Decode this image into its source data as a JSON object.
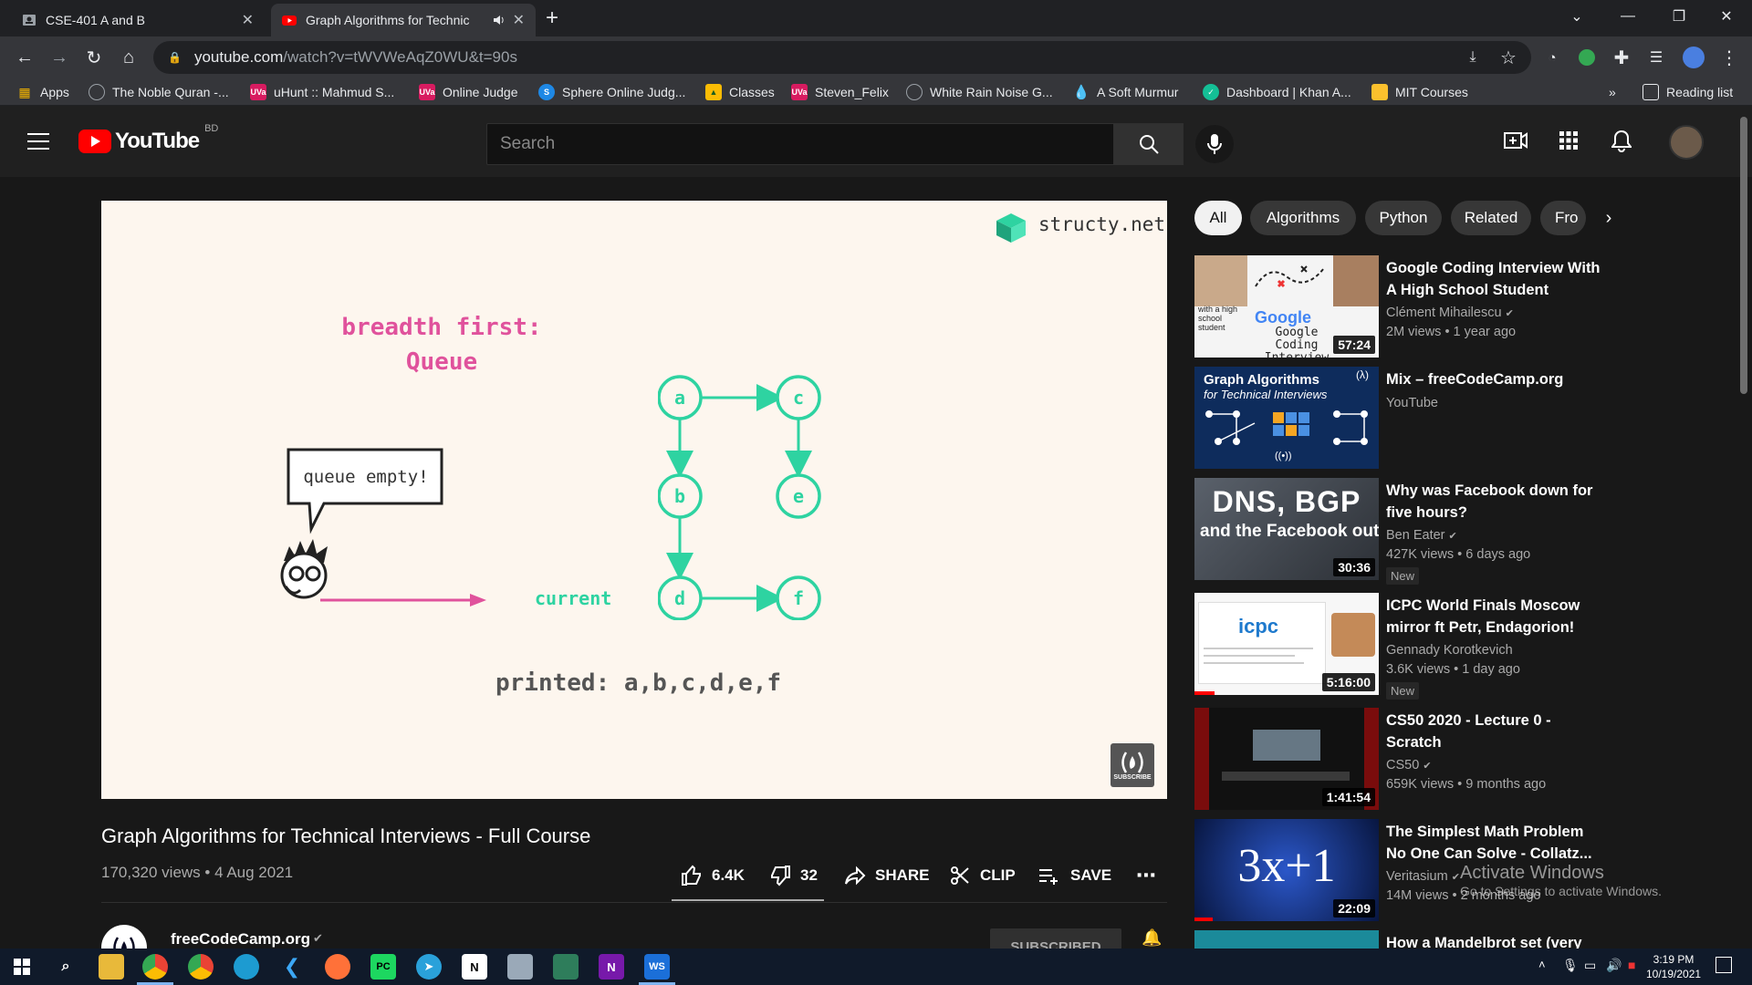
{
  "browser": {
    "tabs": [
      {
        "title": "CSE-401 A and B"
      },
      {
        "title": "Graph Algorithms for Technic"
      }
    ],
    "url_host": "youtube.com",
    "url_path": "/watch?v=tWVWeAqZ0WU&t=90s",
    "bookmarks": [
      {
        "label": "Apps",
        "icon": "apps-grid-icon",
        "color": "#f4b400"
      },
      {
        "label": "The Noble Quran -...",
        "icon": "globe-icon",
        "color": "#9aa0a6"
      },
      {
        "label": "uHunt :: Mahmud S...",
        "icon": "uva-icon",
        "color": "#d81b60"
      },
      {
        "label": "Online Judge",
        "icon": "uva-icon",
        "color": "#d81b60"
      },
      {
        "label": "Sphere Online Judg...",
        "icon": "spoj-icon",
        "color": "#1e88e5"
      },
      {
        "label": "Classes",
        "icon": "classroom-icon",
        "color": "#fbbc04"
      },
      {
        "label": "Steven_Felix",
        "icon": "uva-icon",
        "color": "#d81b60"
      },
      {
        "label": "White Rain Noise G...",
        "icon": "globe-icon",
        "color": "#9aa0a6"
      },
      {
        "label": "A Soft Murmur",
        "icon": "drop-icon",
        "color": "#4fc3f7"
      },
      {
        "label": "Dashboard | Khan A...",
        "icon": "khan-icon",
        "color": "#14bf96"
      },
      {
        "label": "MIT Courses",
        "icon": "folder-icon",
        "color": "#fbc02d"
      }
    ],
    "reading_list": "Reading list",
    "more": "»"
  },
  "youtube": {
    "logo_text": "YouTube",
    "region": "BD",
    "search_placeholder": "Search"
  },
  "slide": {
    "brand": "structy.net",
    "heading_line1": "breadth first:",
    "heading_line2": "Queue",
    "bubble": "queue empty!",
    "current_label": "current",
    "printed": "printed: a,b,c,d,e,f",
    "nodes": [
      "a",
      "b",
      "c",
      "d",
      "e",
      "f"
    ],
    "subscribe": "SUBSCRIBE",
    "accent": "#e0529c",
    "node_color": "#2ed3a1"
  },
  "video": {
    "title": "Graph Algorithms for Technical Interviews - Full Course",
    "meta": "170,320 views • 4 Aug 2021",
    "likes": "6.4K",
    "dislikes": "32",
    "share": "SHARE",
    "clip": "CLIP",
    "save": "SAVE",
    "channel": "freeCodeCamp.org",
    "subscribe": "SUBSCRIBED"
  },
  "chips": [
    "All",
    "Algorithms",
    "Python",
    "Related",
    "Fro"
  ],
  "recommendations": [
    {
      "title": "Google Coding Interview With A High School Student",
      "channel": "Clément Mihailescu",
      "verified": true,
      "stats": "2M views • 1 year ago",
      "duration": "57:24",
      "badge": "",
      "thumb_text": "Google Coding Interview",
      "thumb_sub": "with a high school student"
    },
    {
      "title": "Mix – freeCodeCamp.org",
      "channel": "YouTube",
      "verified": false,
      "stats": "",
      "duration": "",
      "badge": "",
      "thumb_text": "Graph Algorithms",
      "thumb_sub": "for Technical Interviews"
    },
    {
      "title": "Why was Facebook down for five hours?",
      "channel": "Ben Eater",
      "verified": true,
      "stats": "427K views • 6 days ago",
      "duration": "30:36",
      "badge": "New",
      "thumb_text": "DNS, BGP",
      "thumb_sub": "and the Facebook outage"
    },
    {
      "title": "ICPC World Finals Moscow mirror ft Petr, Endagorion!",
      "channel": "Gennady Korotkevich",
      "verified": false,
      "stats": "3.6K views • 1 day ago",
      "duration": "5:16:00",
      "badge": "New",
      "thumb_text": "icpc",
      "thumb_sub": ""
    },
    {
      "title": "CS50 2020 - Lecture 0 - Scratch",
      "channel": "CS50",
      "verified": true,
      "stats": "659K views • 9 months ago",
      "duration": "1:41:54",
      "badge": "",
      "thumb_text": "",
      "thumb_sub": ""
    },
    {
      "title": "The Simplest Math Problem No One Can Solve - Collatz...",
      "channel": "Veritasium",
      "verified": true,
      "stats": "14M views • 2 months ago",
      "duration": "22:09",
      "badge": "",
      "thumb_text": "3x+1",
      "thumb_sub": ""
    },
    {
      "title": "How a Mandelbrot set (very",
      "channel": "",
      "verified": false,
      "stats": "",
      "duration": "",
      "badge": "",
      "thumb_text": "",
      "thumb_sub": ""
    }
  ],
  "watermark": {
    "line1": "Activate Windows",
    "line2": "Go to Settings to activate Windows."
  },
  "taskbar": {
    "time": "3:19 PM",
    "date": "10/19/2021"
  }
}
